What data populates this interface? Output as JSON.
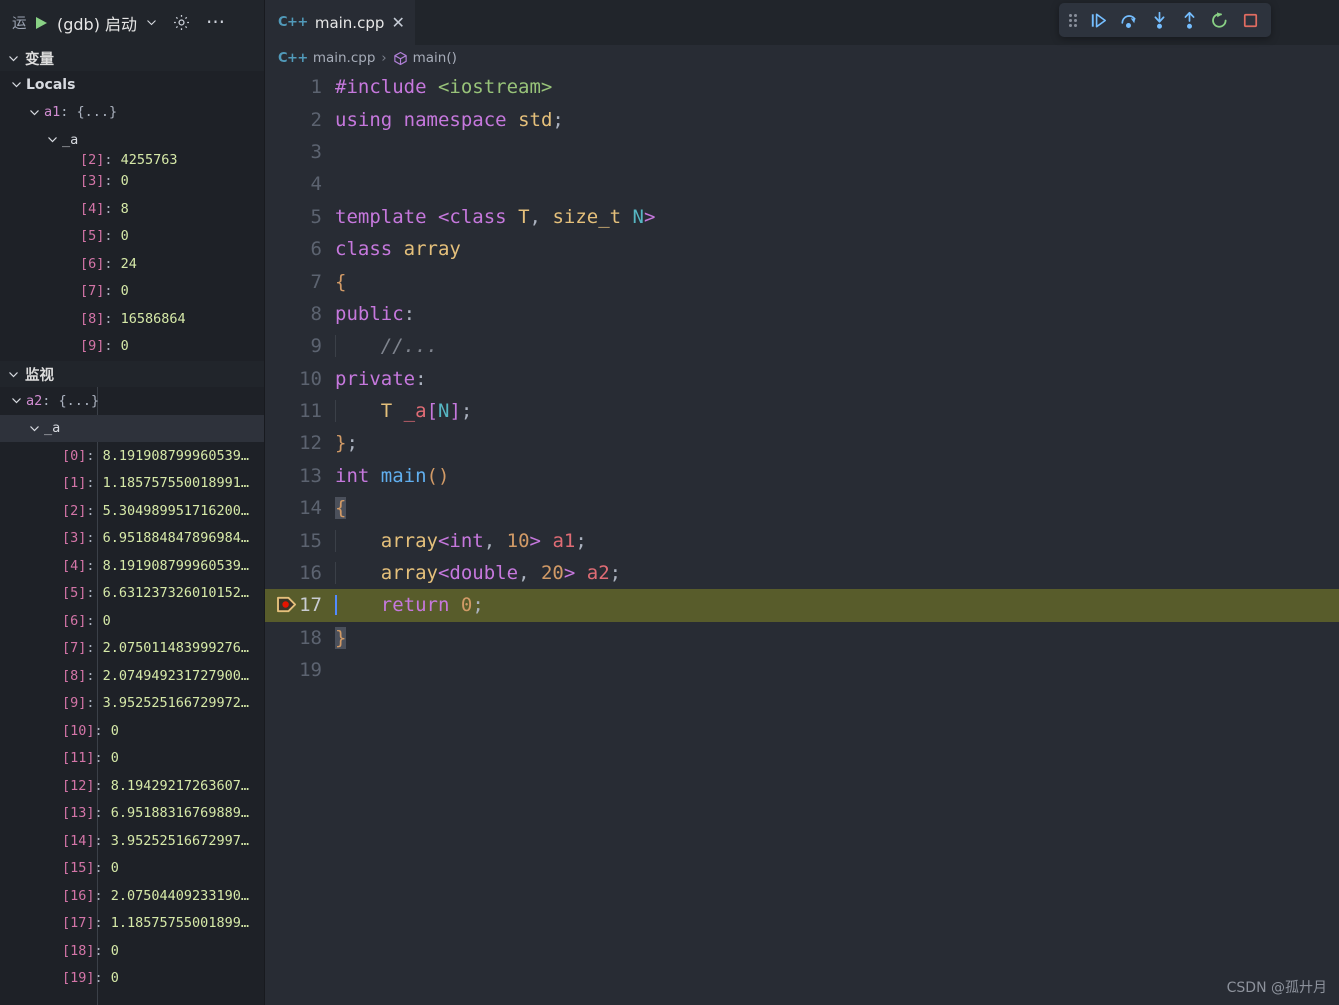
{
  "window": {
    "watermark": "CSDN @孤廾月"
  },
  "debug_launch_bar": {
    "run_label": "运",
    "play_icon": "play-icon",
    "config_name": "(gdb) 启动",
    "chevron_icon": "chevron-down-icon",
    "gear_icon": "gear-icon",
    "more_icon": "more-ellipsis-icon"
  },
  "debug_toolbar": {
    "grip_icon": "drag-handle-icon",
    "buttons": [
      {
        "name": "continue-button",
        "icon": "continue-icon",
        "color": "#75beff"
      },
      {
        "name": "step-over-button",
        "icon": "step-over-icon",
        "color": "#75beff"
      },
      {
        "name": "step-into-button",
        "icon": "step-into-icon",
        "color": "#75beff"
      },
      {
        "name": "step-out-button",
        "icon": "step-out-icon",
        "color": "#75beff"
      },
      {
        "name": "restart-button",
        "icon": "restart-icon",
        "color": "#89d185"
      },
      {
        "name": "stop-button",
        "icon": "stop-icon",
        "color": "#e06c61"
      }
    ]
  },
  "sidebar": {
    "variables_section": {
      "title": "变量",
      "expanded": true,
      "rows": [
        {
          "indent": 1,
          "twisty": "expanded",
          "name": "Locals",
          "style": "locals"
        },
        {
          "indent": 2,
          "twisty": "expanded",
          "name": "a1",
          "sep": ": ",
          "value": "{...}",
          "style": "struct"
        },
        {
          "indent": 3,
          "twisty": "expanded",
          "name": "_a",
          "style": "plain"
        },
        {
          "indent": 4,
          "twisty": "none",
          "name": "[2]",
          "sep": ": ",
          "value": "4255763",
          "style": "num",
          "clipped": true
        },
        {
          "indent": 4,
          "twisty": "none",
          "name": "[3]",
          "sep": ": ",
          "value": "0",
          "style": "num"
        },
        {
          "indent": 4,
          "twisty": "none",
          "name": "[4]",
          "sep": ": ",
          "value": "8",
          "style": "num"
        },
        {
          "indent": 4,
          "twisty": "none",
          "name": "[5]",
          "sep": ": ",
          "value": "0",
          "style": "num"
        },
        {
          "indent": 4,
          "twisty": "none",
          "name": "[6]",
          "sep": ": ",
          "value": "24",
          "style": "num"
        },
        {
          "indent": 4,
          "twisty": "none",
          "name": "[7]",
          "sep": ": ",
          "value": "0",
          "style": "num"
        },
        {
          "indent": 4,
          "twisty": "none",
          "name": "[8]",
          "sep": ": ",
          "value": "16586864",
          "style": "num"
        },
        {
          "indent": 4,
          "twisty": "none",
          "name": "[9]",
          "sep": ": ",
          "value": "0",
          "style": "num"
        }
      ]
    },
    "watch_section": {
      "title": "监视",
      "expanded": true,
      "rows": [
        {
          "indent": 1,
          "twisty": "expanded",
          "name": "a2",
          "sep": ": ",
          "value": "{...}",
          "style": "struct"
        },
        {
          "indent": 2,
          "twisty": "expanded",
          "name": "_a",
          "style": "plain",
          "selected": true
        },
        {
          "indent": 3,
          "twisty": "none",
          "name": "[0]",
          "sep": ": ",
          "value": "8.191908799960539…",
          "style": "num"
        },
        {
          "indent": 3,
          "twisty": "none",
          "name": "[1]",
          "sep": ": ",
          "value": "1.185757550018991…",
          "style": "num"
        },
        {
          "indent": 3,
          "twisty": "none",
          "name": "[2]",
          "sep": ": ",
          "value": "5.304989951716200…",
          "style": "num"
        },
        {
          "indent": 3,
          "twisty": "none",
          "name": "[3]",
          "sep": ": ",
          "value": "6.951884847896984…",
          "style": "num"
        },
        {
          "indent": 3,
          "twisty": "none",
          "name": "[4]",
          "sep": ": ",
          "value": "8.191908799960539…",
          "style": "num"
        },
        {
          "indent": 3,
          "twisty": "none",
          "name": "[5]",
          "sep": ": ",
          "value": "6.631237326010152…",
          "style": "num"
        },
        {
          "indent": 3,
          "twisty": "none",
          "name": "[6]",
          "sep": ": ",
          "value": "0",
          "style": "num"
        },
        {
          "indent": 3,
          "twisty": "none",
          "name": "[7]",
          "sep": ": ",
          "value": "2.075011483999276…",
          "style": "num"
        },
        {
          "indent": 3,
          "twisty": "none",
          "name": "[8]",
          "sep": ": ",
          "value": "2.074949231727900…",
          "style": "num"
        },
        {
          "indent": 3,
          "twisty": "none",
          "name": "[9]",
          "sep": ": ",
          "value": "3.952525166729972…",
          "style": "num"
        },
        {
          "indent": 3,
          "twisty": "none",
          "name": "[10]",
          "sep": ": ",
          "value": "0",
          "style": "num"
        },
        {
          "indent": 3,
          "twisty": "none",
          "name": "[11]",
          "sep": ": ",
          "value": "0",
          "style": "num"
        },
        {
          "indent": 3,
          "twisty": "none",
          "name": "[12]",
          "sep": ": ",
          "value": "8.19429217263607…",
          "style": "num"
        },
        {
          "indent": 3,
          "twisty": "none",
          "name": "[13]",
          "sep": ": ",
          "value": "6.95188316769889…",
          "style": "num"
        },
        {
          "indent": 3,
          "twisty": "none",
          "name": "[14]",
          "sep": ": ",
          "value": "3.95252516672997…",
          "style": "num"
        },
        {
          "indent": 3,
          "twisty": "none",
          "name": "[15]",
          "sep": ": ",
          "value": "0",
          "style": "num"
        },
        {
          "indent": 3,
          "twisty": "none",
          "name": "[16]",
          "sep": ": ",
          "value": "2.07504409233190…",
          "style": "num"
        },
        {
          "indent": 3,
          "twisty": "none",
          "name": "[17]",
          "sep": ": ",
          "value": "1.18575755001899…",
          "style": "num"
        },
        {
          "indent": 3,
          "twisty": "none",
          "name": "[18]",
          "sep": ": ",
          "value": "0",
          "style": "num"
        },
        {
          "indent": 3,
          "twisty": "none",
          "name": "[19]",
          "sep": ": ",
          "value": "0",
          "style": "num"
        }
      ]
    }
  },
  "editor": {
    "tab": {
      "icon": "cpp-file-icon",
      "icon_text": "C++",
      "title": "main.cpp",
      "close_icon": "close-icon",
      "close_glyph": "✕"
    },
    "breadcrumb": [
      {
        "icon": "cpp-file-icon",
        "icon_text": "C++",
        "label": "main.cpp"
      },
      {
        "icon": "symbol-method-icon",
        "label": "main()"
      }
    ],
    "breadcrumb_separator": "›",
    "current_line": 17,
    "marker_line": 17,
    "marker_icon": "debug-stackframe-breakpoint-icon",
    "lines": [
      {
        "n": 1,
        "tokens": [
          {
            "t": "#include ",
            "c": "key"
          },
          {
            "t": "<iostream>",
            "c": "str"
          }
        ]
      },
      {
        "n": 2,
        "tokens": [
          {
            "t": "using",
            "c": "key"
          },
          {
            "t": " ",
            "c": "plain"
          },
          {
            "t": "namespace",
            "c": "key"
          },
          {
            "t": " ",
            "c": "plain"
          },
          {
            "t": "std",
            "c": "type"
          },
          {
            "t": ";",
            "c": "punc"
          }
        ]
      },
      {
        "n": 3,
        "tokens": []
      },
      {
        "n": 4,
        "tokens": []
      },
      {
        "n": 5,
        "tokens": [
          {
            "t": "template",
            "c": "key"
          },
          {
            "t": " ",
            "c": "plain"
          },
          {
            "t": "<",
            "c": "ang"
          },
          {
            "t": "class",
            "c": "key"
          },
          {
            "t": " ",
            "c": "plain"
          },
          {
            "t": "T",
            "c": "type"
          },
          {
            "t": ",",
            "c": "punc"
          },
          {
            "t": " ",
            "c": "plain"
          },
          {
            "t": "size_t",
            "c": "type"
          },
          {
            "t": " ",
            "c": "plain"
          },
          {
            "t": "N",
            "c": "tparam"
          },
          {
            "t": ">",
            "c": "ang"
          }
        ]
      },
      {
        "n": 6,
        "tokens": [
          {
            "t": "class",
            "c": "key"
          },
          {
            "t": " ",
            "c": "plain"
          },
          {
            "t": "array",
            "c": "type"
          }
        ]
      },
      {
        "n": 7,
        "tokens": [
          {
            "t": "{",
            "c": "brace"
          }
        ]
      },
      {
        "n": 8,
        "tokens": [
          {
            "t": "public",
            "c": "key"
          },
          {
            "t": ":",
            "c": "punc"
          }
        ]
      },
      {
        "n": 9,
        "tokens": [
          {
            "t": "    ",
            "c": "plain"
          },
          {
            "t": "//...",
            "c": "cmt"
          }
        ],
        "indent_guides": 1
      },
      {
        "n": 10,
        "tokens": [
          {
            "t": "private",
            "c": "key"
          },
          {
            "t": ":",
            "c": "punc"
          }
        ]
      },
      {
        "n": 11,
        "tokens": [
          {
            "t": "    ",
            "c": "plain"
          },
          {
            "t": "T",
            "c": "type"
          },
          {
            "t": " ",
            "c": "plain"
          },
          {
            "t": "_a",
            "c": "var"
          },
          {
            "t": "[",
            "c": "ang"
          },
          {
            "t": "N",
            "c": "tparam"
          },
          {
            "t": "]",
            "c": "ang"
          },
          {
            "t": ";",
            "c": "punc"
          }
        ],
        "indent_guides": 1
      },
      {
        "n": 12,
        "tokens": [
          {
            "t": "}",
            "c": "brace"
          },
          {
            "t": ";",
            "c": "punc"
          }
        ]
      },
      {
        "n": 13,
        "tokens": [
          {
            "t": "int",
            "c": "key"
          },
          {
            "t": " ",
            "c": "plain"
          },
          {
            "t": "main",
            "c": "fn"
          },
          {
            "t": "()",
            "c": "brace"
          }
        ]
      },
      {
        "n": 14,
        "tokens": [
          {
            "t": "{",
            "c": "brace"
          }
        ],
        "bracket_match": true
      },
      {
        "n": 15,
        "tokens": [
          {
            "t": "    ",
            "c": "plain"
          },
          {
            "t": "array",
            "c": "type"
          },
          {
            "t": "<",
            "c": "ang"
          },
          {
            "t": "int",
            "c": "key"
          },
          {
            "t": ",",
            "c": "punc"
          },
          {
            "t": " ",
            "c": "plain"
          },
          {
            "t": "10",
            "c": "num"
          },
          {
            "t": ">",
            "c": "ang"
          },
          {
            "t": " ",
            "c": "plain"
          },
          {
            "t": "a1",
            "c": "var"
          },
          {
            "t": ";",
            "c": "punc"
          }
        ],
        "indent_guides": 1
      },
      {
        "n": 16,
        "tokens": [
          {
            "t": "    ",
            "c": "plain"
          },
          {
            "t": "array",
            "c": "type"
          },
          {
            "t": "<",
            "c": "ang"
          },
          {
            "t": "double",
            "c": "key"
          },
          {
            "t": ",",
            "c": "punc"
          },
          {
            "t": " ",
            "c": "plain"
          },
          {
            "t": "20",
            "c": "num"
          },
          {
            "t": ">",
            "c": "ang"
          },
          {
            "t": " ",
            "c": "plain"
          },
          {
            "t": "a2",
            "c": "var"
          },
          {
            "t": ";",
            "c": "punc"
          }
        ],
        "indent_guides": 1
      },
      {
        "n": 17,
        "tokens": [
          {
            "t": "    ",
            "c": "plain"
          },
          {
            "t": "return",
            "c": "key"
          },
          {
            "t": " ",
            "c": "plain"
          },
          {
            "t": "0",
            "c": "num"
          },
          {
            "t": ";",
            "c": "punc"
          }
        ],
        "highlight": true,
        "cursor": true
      },
      {
        "n": 18,
        "tokens": [
          {
            "t": "}",
            "c": "brace"
          }
        ],
        "bracket_match": true
      },
      {
        "n": 19,
        "tokens": []
      }
    ]
  },
  "colors": {
    "sidebar_bg": "#21252b",
    "tree_bg": "#1e2127",
    "editor_bg": "#282c34",
    "debug_line_highlight": "#585c2b",
    "cursor": "#528bff",
    "accent_blue": "#75beff",
    "accent_green": "#89d185",
    "accent_red": "#e06c61"
  }
}
